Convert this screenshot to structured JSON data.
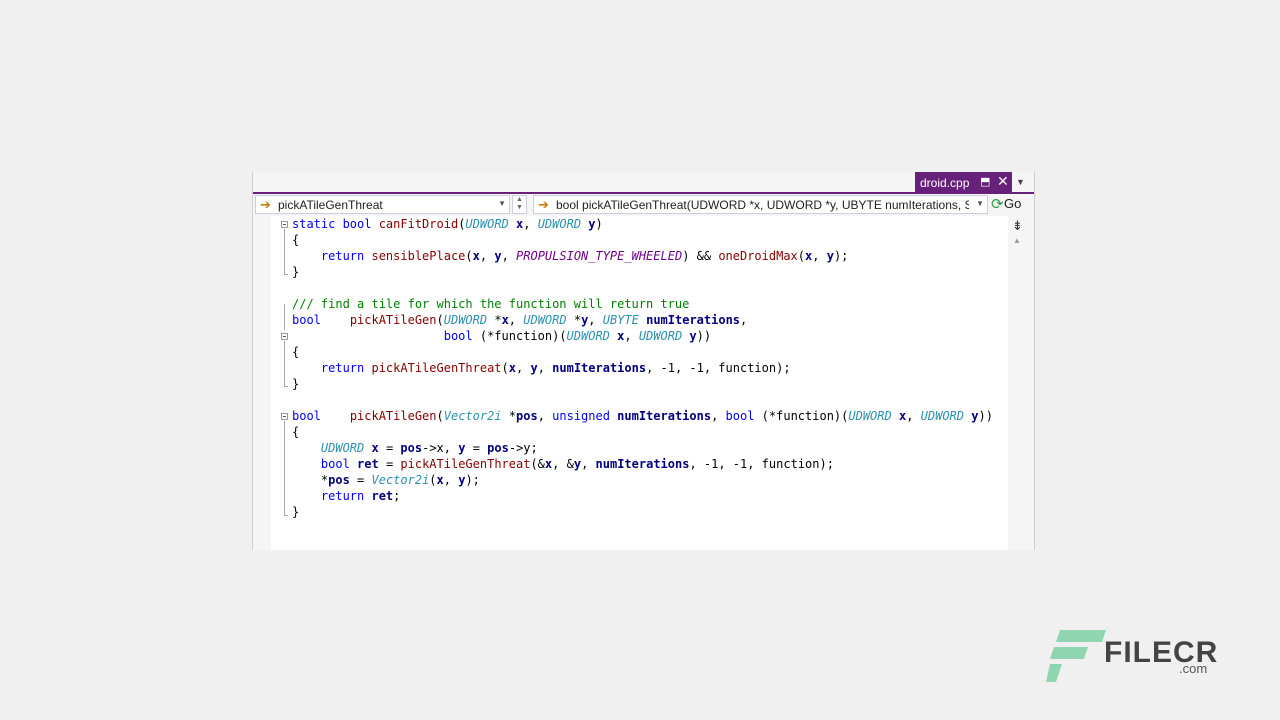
{
  "tab": {
    "title": "droid.cpp",
    "pin_glyph": "⬒",
    "close_glyph": "✕",
    "dropdown_glyph": "▼"
  },
  "nav": {
    "member": "pickATileGenThreat",
    "signature": "bool pickATileGenThreat(UDWORD *x, UDWORD *y, UBYTE numIterations, SDWORD threatRange, SDWORD player, bool (*function)(UDWORD x, UDWORD y))",
    "go_label": "Go",
    "arrow_glyph": "➔",
    "dropdown_glyph": "▼",
    "spin_up": "▲",
    "spin_down": "▼"
  },
  "scrollbar": {
    "split_glyph": "⇟",
    "up_glyph": "▲"
  },
  "code": {
    "lines": [
      [
        [
          "kw",
          "static "
        ],
        [
          "kw",
          "bool "
        ],
        [
          "fn",
          "canFitDroid"
        ],
        [
          "pl",
          "("
        ],
        [
          "ty",
          "UDWORD"
        ],
        [
          "pl",
          " "
        ],
        [
          "var",
          "x"
        ],
        [
          "pl",
          ", "
        ],
        [
          "ty",
          "UDWORD"
        ],
        [
          "pl",
          " "
        ],
        [
          "var",
          "y"
        ],
        [
          "pl",
          ")"
        ]
      ],
      [
        [
          "pl",
          "{"
        ]
      ],
      [
        [
          "pl",
          "    "
        ],
        [
          "kw",
          "return "
        ],
        [
          "fn",
          "sensiblePlace"
        ],
        [
          "pl",
          "("
        ],
        [
          "var",
          "x"
        ],
        [
          "pl",
          ", "
        ],
        [
          "var",
          "y"
        ],
        [
          "pl",
          ", "
        ],
        [
          "mac",
          "PROPULSION_TYPE_WHEELED"
        ],
        [
          "pl",
          ") && "
        ],
        [
          "fn",
          "oneDroidMax"
        ],
        [
          "pl",
          "("
        ],
        [
          "var",
          "x"
        ],
        [
          "pl",
          ", "
        ],
        [
          "var",
          "y"
        ],
        [
          "pl",
          ");"
        ]
      ],
      [
        [
          "pl",
          "}"
        ]
      ],
      [
        [
          "pl",
          ""
        ]
      ],
      [
        [
          "cm",
          "/// find a tile for which the function will return true"
        ]
      ],
      [
        [
          "kw",
          "bool"
        ],
        [
          "pl",
          "    "
        ],
        [
          "fn",
          "pickATileGen"
        ],
        [
          "pl",
          "("
        ],
        [
          "ty",
          "UDWORD"
        ],
        [
          "pl",
          " *"
        ],
        [
          "var",
          "x"
        ],
        [
          "pl",
          ", "
        ],
        [
          "ty",
          "UDWORD"
        ],
        [
          "pl",
          " *"
        ],
        [
          "var",
          "y"
        ],
        [
          "pl",
          ", "
        ],
        [
          "ty",
          "UBYTE"
        ],
        [
          "pl",
          " "
        ],
        [
          "var",
          "numIterations"
        ],
        [
          "pl",
          ","
        ]
      ],
      [
        [
          "pl",
          "                     "
        ],
        [
          "kw",
          "bool"
        ],
        [
          "pl",
          " (*function)("
        ],
        [
          "ty",
          "UDWORD"
        ],
        [
          "pl",
          " "
        ],
        [
          "var",
          "x"
        ],
        [
          "pl",
          ", "
        ],
        [
          "ty",
          "UDWORD"
        ],
        [
          "pl",
          " "
        ],
        [
          "var",
          "y"
        ],
        [
          "pl",
          "))"
        ]
      ],
      [
        [
          "pl",
          "{"
        ]
      ],
      [
        [
          "pl",
          "    "
        ],
        [
          "kw",
          "return "
        ],
        [
          "fn",
          "pickATileGenThreat"
        ],
        [
          "pl",
          "("
        ],
        [
          "var",
          "x"
        ],
        [
          "pl",
          ", "
        ],
        [
          "var",
          "y"
        ],
        [
          "pl",
          ", "
        ],
        [
          "var",
          "numIterations"
        ],
        [
          "pl",
          ", -1, -1, function);"
        ]
      ],
      [
        [
          "pl",
          "}"
        ]
      ],
      [
        [
          "pl",
          ""
        ]
      ],
      [
        [
          "kw",
          "bool"
        ],
        [
          "pl",
          "    "
        ],
        [
          "fn",
          "pickATileGen"
        ],
        [
          "pl",
          "("
        ],
        [
          "ty",
          "Vector2i"
        ],
        [
          "pl",
          " *"
        ],
        [
          "var",
          "pos"
        ],
        [
          "pl",
          ", "
        ],
        [
          "kw",
          "unsigned "
        ],
        [
          "var",
          "numIterations"
        ],
        [
          "pl",
          ", "
        ],
        [
          "kw",
          "bool"
        ],
        [
          "pl",
          " (*function)("
        ],
        [
          "ty",
          "UDWORD"
        ],
        [
          "pl",
          " "
        ],
        [
          "var",
          "x"
        ],
        [
          "pl",
          ", "
        ],
        [
          "ty",
          "UDWORD"
        ],
        [
          "pl",
          " "
        ],
        [
          "var",
          "y"
        ],
        [
          "pl",
          "))"
        ]
      ],
      [
        [
          "pl",
          "{"
        ]
      ],
      [
        [
          "pl",
          "    "
        ],
        [
          "ty",
          "UDWORD"
        ],
        [
          "pl",
          " "
        ],
        [
          "var",
          "x"
        ],
        [
          "pl",
          " = "
        ],
        [
          "var",
          "pos"
        ],
        [
          "pl",
          "->x, "
        ],
        [
          "var",
          "y"
        ],
        [
          "pl",
          " = "
        ],
        [
          "var",
          "pos"
        ],
        [
          "pl",
          "->y;"
        ]
      ],
      [
        [
          "pl",
          "    "
        ],
        [
          "kw",
          "bool "
        ],
        [
          "var",
          "ret"
        ],
        [
          "pl",
          " = "
        ],
        [
          "fn",
          "pickATileGenThreat"
        ],
        [
          "pl",
          "(&"
        ],
        [
          "var",
          "x"
        ],
        [
          "pl",
          ", &"
        ],
        [
          "var",
          "y"
        ],
        [
          "pl",
          ", "
        ],
        [
          "var",
          "numIterations"
        ],
        [
          "pl",
          ", -1, -1, function);"
        ]
      ],
      [
        [
          "pl",
          "    *"
        ],
        [
          "var",
          "pos"
        ],
        [
          "pl",
          " = "
        ],
        [
          "ty",
          "Vector2i"
        ],
        [
          "pl",
          "("
        ],
        [
          "var",
          "x"
        ],
        [
          "pl",
          ", "
        ],
        [
          "var",
          "y"
        ],
        [
          "pl",
          ");"
        ]
      ],
      [
        [
          "pl",
          "    "
        ],
        [
          "kw",
          "return "
        ],
        [
          "var",
          "ret"
        ],
        [
          "pl",
          ";"
        ]
      ],
      [
        [
          "pl",
          "}"
        ]
      ]
    ]
  },
  "watermark": {
    "brand": "FILECR",
    "domain": ".com"
  }
}
